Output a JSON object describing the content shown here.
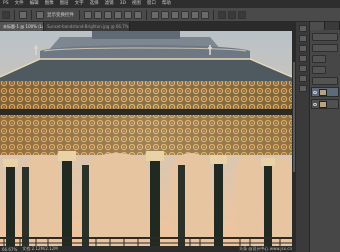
{
  "app": {
    "name": "Adobe Photoshop"
  },
  "menubar": {
    "items": [
      "PS",
      "文件",
      "编辑",
      "图像",
      "图层",
      "文字",
      "选择",
      "滤镜",
      "3D",
      "视图",
      "窗口",
      "帮助"
    ]
  },
  "options_bar": {
    "mode_label": "显示变换控件"
  },
  "tabs": [
    {
      "label": "未标题-1 @ 100% (Layer 0, RGB/8)",
      "active": true
    },
    {
      "label": "Sunset-bandstand-Brighton.jpg @ 66.7% (RGB/8#)",
      "active": false
    }
  ],
  "status": {
    "zoom": "66.67%",
    "doc_info": "文档:2.12M/2.12M"
  },
  "watermark": {
    "text": "头条 @设计中心 www.jsx.cn"
  },
  "colors": {
    "sky_top": "#b9c2c7",
    "sky_horizon": "#f1c49b",
    "roof": "#7c8791",
    "iron": "#1f2a22",
    "ornament": "#c79a4a",
    "pillar": "#e8d2a6",
    "ui_dark": "#2e2e2e",
    "ui_mid": "#4a4a4a"
  },
  "panel": {
    "icons": [
      "eye-icon",
      "layer-thumbnail-icon"
    ]
  }
}
